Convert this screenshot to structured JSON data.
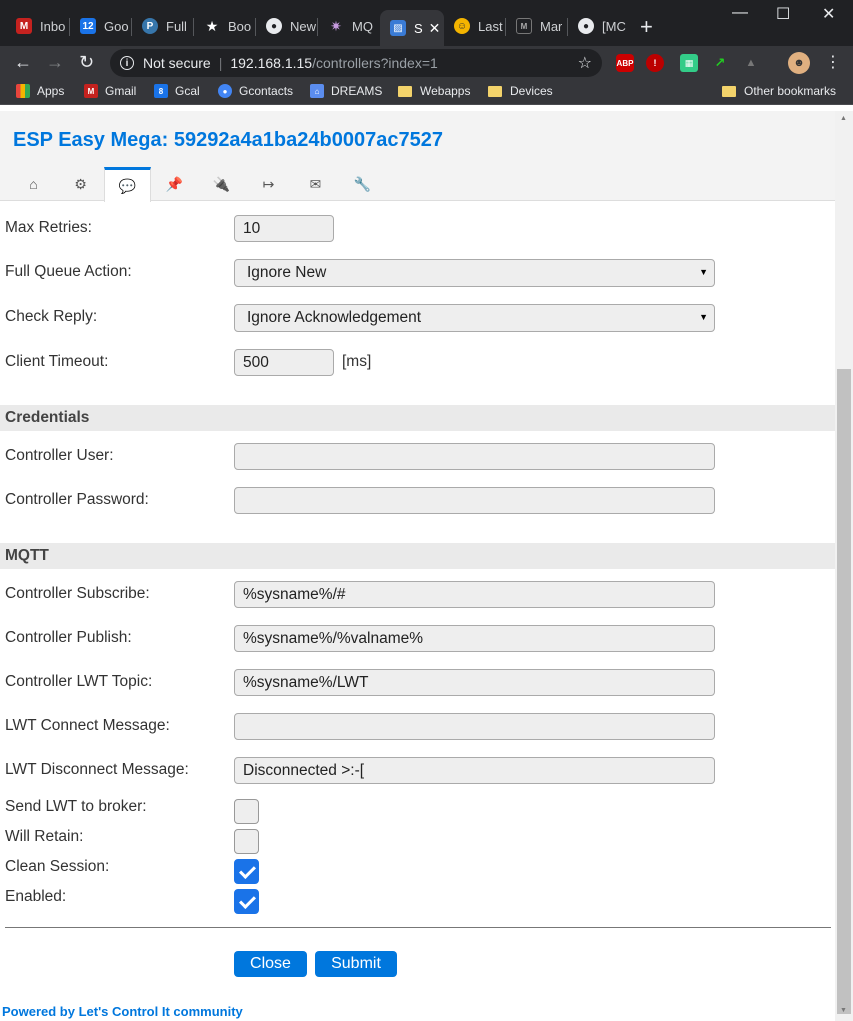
{
  "browser": {
    "tabs": [
      {
        "title": "Inbo",
        "icon_name": "gmail-icon",
        "color": "#c5221f",
        "glyph": "M"
      },
      {
        "title": "Goo",
        "icon_name": "calendar-icon",
        "color": "#1a73e8",
        "glyph": "12"
      },
      {
        "title": "Full",
        "icon_name": "python-icon",
        "color": "#3776ab",
        "glyph": "P"
      },
      {
        "title": "Boo",
        "icon_name": "star-icon",
        "color": "#5f6368",
        "glyph": "★"
      },
      {
        "title": "New",
        "icon_name": "github-icon",
        "color": "#24292e",
        "glyph": "●"
      },
      {
        "title": "MQ",
        "icon_name": "mqtt-icon",
        "color": "#660066",
        "glyph": "✷"
      },
      {
        "title": "S",
        "icon_name": "espeasy-icon",
        "color": "#3a7bd5",
        "glyph": "▨"
      },
      {
        "title": "Last",
        "icon_name": "smiley-icon",
        "color": "#f4b400",
        "glyph": "☺"
      },
      {
        "title": "Mar",
        "icon_name": "markdown-icon",
        "color": "#5f6368",
        "glyph": "M"
      },
      {
        "title": "[MC",
        "icon_name": "github-icon",
        "color": "#24292e",
        "glyph": "●"
      }
    ],
    "new_tab": "+",
    "window_minimize": "—",
    "window_maximize": "☐",
    "window_close": "✕",
    "address": {
      "security": "Not secure",
      "host": "192.168.1.15",
      "path": "/controllers?index=1"
    },
    "extensions": [
      {
        "name": "adblock-icon",
        "label": "ABP",
        "color": "#c00"
      },
      {
        "name": "extension-icon",
        "label": "!",
        "color": "#b00"
      },
      {
        "name": "map-extension-icon",
        "label": "▦",
        "color": "#3c8"
      },
      {
        "name": "green-extension-icon",
        "label": "↗",
        "color": "#2a2"
      },
      {
        "name": "mountain-extension-icon",
        "label": "▲",
        "color": "#666"
      }
    ],
    "bookmarks": [
      {
        "label": "Apps",
        "icon_name": "apps-grid-icon",
        "color": "#e8453c"
      },
      {
        "label": "Gmail",
        "icon_name": "gmail-icon",
        "color": "#c5221f"
      },
      {
        "label": "Gcal",
        "icon_name": "calendar-icon",
        "color": "#1a73e8"
      },
      {
        "label": "Gcontacts",
        "icon_name": "contacts-icon",
        "color": "#4285f4"
      },
      {
        "label": "DREAMS",
        "icon_name": "dreams-icon",
        "color": "#5b8def"
      },
      {
        "label": "Webapps",
        "icon_name": "folder-icon",
        "color": "#f3d36b"
      },
      {
        "label": "Devices",
        "icon_name": "folder-icon",
        "color": "#f3d36b"
      }
    ],
    "other_bookmarks": "Other bookmarks"
  },
  "header": {
    "title": "ESP Easy Mega: 59292a4a1ba24b0007ac7527"
  },
  "menu": [
    {
      "name": "home",
      "glyph": "⌂"
    },
    {
      "name": "config",
      "glyph": "⚙"
    },
    {
      "name": "controllers",
      "glyph": "💬",
      "active": true
    },
    {
      "name": "hardware",
      "glyph": "📌"
    },
    {
      "name": "devices",
      "glyph": "🔌"
    },
    {
      "name": "rules",
      "glyph": "↦"
    },
    {
      "name": "notifications",
      "glyph": "✉"
    },
    {
      "name": "tools",
      "glyph": "🔧"
    }
  ],
  "form": {
    "max_retries_label": "Max Retries:",
    "max_retries": "10",
    "full_queue_label": "Full Queue Action:",
    "full_queue": "Ignore New",
    "check_reply_label": "Check Reply:",
    "check_reply": "Ignore Acknowledgement",
    "client_timeout_label": "Client Timeout:",
    "client_timeout": "500",
    "client_timeout_unit": "[ms]",
    "credentials_header": "Credentials",
    "controller_user_label": "Controller User:",
    "controller_user": "",
    "controller_password_label": "Controller Password:",
    "controller_password": "",
    "mqtt_header": "MQTT",
    "subscribe_label": "Controller Subscribe:",
    "subscribe": "%sysname%/#",
    "publish_label": "Controller Publish:",
    "publish": "%sysname%/%valname%",
    "lwt_topic_label": "Controller LWT Topic:",
    "lwt_topic": "%sysname%/LWT",
    "lwt_connect_label": "LWT Connect Message:",
    "lwt_connect": "",
    "lwt_disconnect_label": "LWT Disconnect Message:",
    "lwt_disconnect": "Disconnected >:-[",
    "send_lwt_label": "Send LWT to broker:",
    "send_lwt": false,
    "will_retain_label": "Will Retain:",
    "will_retain": false,
    "clean_session_label": "Clean Session:",
    "clean_session": true,
    "enabled_label": "Enabled:",
    "enabled": true,
    "close_label": "Close",
    "submit_label": "Submit"
  },
  "footer": {
    "powered_by": "Powered by",
    "brand": "Let's Control It",
    "community": "community"
  }
}
